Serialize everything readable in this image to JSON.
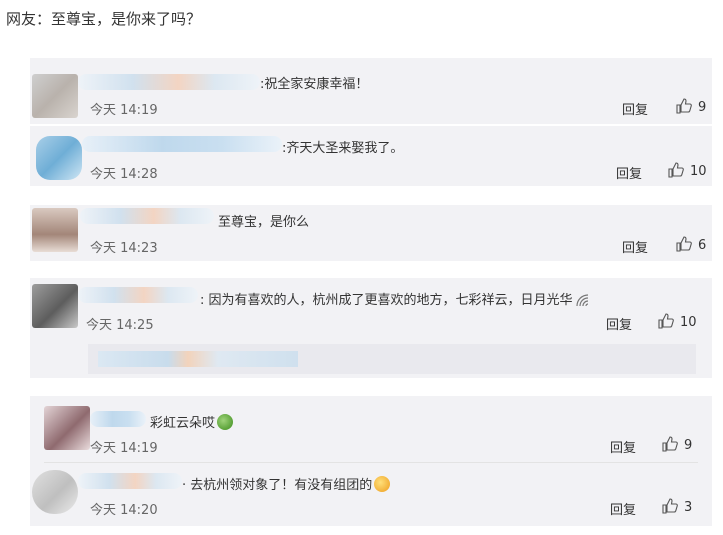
{
  "heading": "网友：至尊宝，是你来了吗？",
  "comments": [
    {
      "text": ":祝全家安康幸福！",
      "time": "今天 14:19",
      "reply": "回复",
      "likes": "9"
    },
    {
      "text": ":齐天大圣来娶我了。",
      "time": "今天 14:28",
      "reply": "回复",
      "likes": "10"
    },
    {
      "text": "至尊宝，是你么",
      "time": "今天 14:23",
      "reply": "回复",
      "likes": "6"
    },
    {
      "text": ": 因为有喜欢的人，杭州成了更喜欢的地方，七彩祥云，日月光华",
      "time": "今天 14:25",
      "reply": "回复",
      "likes": "10"
    },
    {
      "text": "彩虹云朵哎",
      "time": "今天 14:19",
      "reply": "回复",
      "likes": "9"
    },
    {
      "text": "· 去杭州领对象了！有没有组团的",
      "time": "今天 14:20",
      "reply": "回复",
      "likes": "3"
    }
  ],
  "icons": {
    "like": "thumbs-up-icon",
    "feed": "feed-icon",
    "emoji_green": "green-face-emoji",
    "emoji_yellow": "yellow-face-emoji"
  }
}
